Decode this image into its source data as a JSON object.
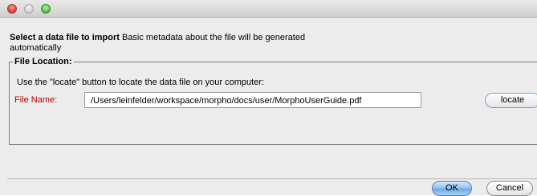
{
  "window": {
    "title_buttons": [
      "close",
      "minimize",
      "zoom"
    ]
  },
  "dialog": {
    "heading_bold": "Select a data file to import",
    "heading_text": " Basic metadata about the file will be generated automatically"
  },
  "file_location": {
    "legend": "File Location:",
    "instruction": "Use the \"locate\" button to locate the data file on your computer:",
    "file_name_label": "File Name:",
    "file_name_value": "/Users/leinfelder/workspace/morpho/docs/user/MorphoUserGuide.pdf",
    "locate_label": "locate"
  },
  "buttons": {
    "ok_label": "OK",
    "cancel_label": "Cancel"
  },
  "colors": {
    "label_red": "#c00000",
    "default_button_blue": "#8fc0ef"
  }
}
